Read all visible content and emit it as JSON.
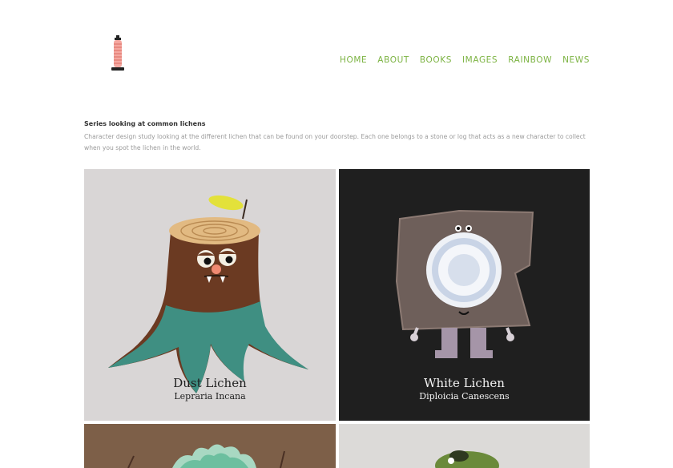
{
  "nav": {
    "items": [
      "HOME",
      "ABOUT",
      "BOOKS",
      "IMAGES",
      "RAINBOW",
      "NEWS"
    ]
  },
  "intro": {
    "title": "Series looking at common lichens",
    "description": "Character design study looking at the different lichen that can be found on your doorstep. Each one belongs to a stone or log that acts as a new character to collect when you spot the lichen in the world."
  },
  "gallery": [
    {
      "name": "Dust Lichen",
      "scientific": "Lepraria Incana",
      "background": "#d9d6d6",
      "text_color": "#1f1f1f"
    },
    {
      "name": "White Lichen",
      "scientific": "Diploicia Canescens",
      "background": "#1f1f1f",
      "text_color": "#f2f2f2"
    },
    {
      "name": "",
      "scientific": "",
      "background": "#7d5f48",
      "text_color": "#ffffff"
    },
    {
      "name": "",
      "scientific": "",
      "background": "#dcdad8",
      "text_color": "#1f1f1f"
    }
  ],
  "colors": {
    "accent": "#7cb342",
    "body_text": "#9a9a9a",
    "heading": "#333333"
  },
  "icons": {
    "logo": "lighthouse-icon"
  }
}
